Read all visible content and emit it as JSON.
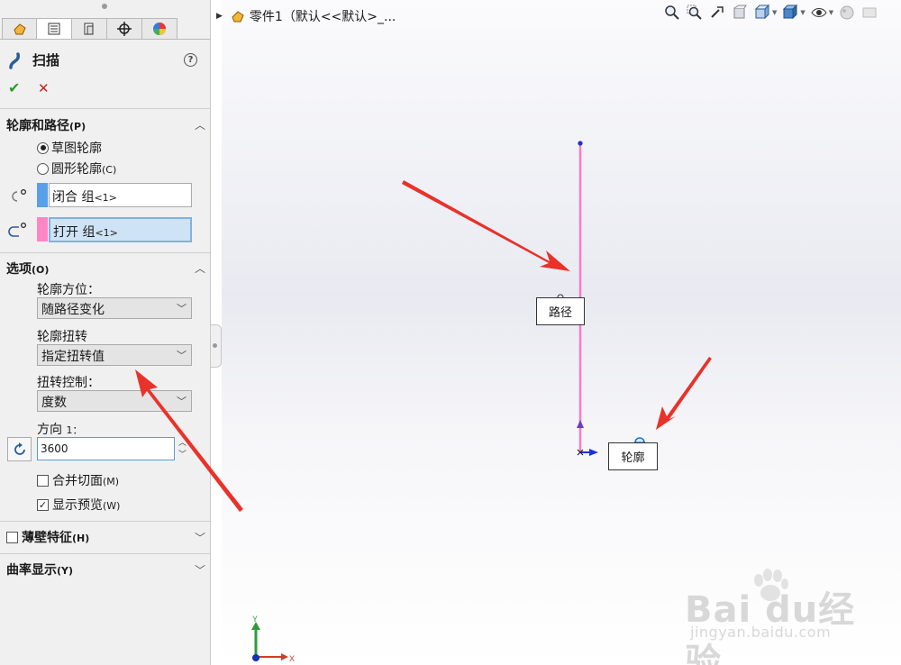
{
  "feature": {
    "title": "扫描",
    "help": "?",
    "ok_glyph": "✔",
    "cancel_glyph": "✕"
  },
  "sections": {
    "profile_path": {
      "title": "轮廓和路径",
      "key": "(P)",
      "radio_sketch": "草图轮廓",
      "radio_circle": "圆形轮廓",
      "radio_circle_key": "(C)",
      "profile_value": "闭合 组",
      "profile_suffix": "<1>",
      "path_value": "打开 组",
      "path_suffix": "<1>"
    },
    "options": {
      "title": "选项",
      "key": "(O)",
      "orientation_label": "轮廓方位：",
      "orientation_value": "随路径变化",
      "twist_label": "轮廓扭转",
      "twist_value": "指定扭转值",
      "twist_ctrl_label": "扭转控制：",
      "twist_ctrl_value": "度数",
      "direction_label": "方向",
      "direction_num": "1：",
      "direction_value": "3600",
      "merge_label": "合并切面",
      "merge_key": "(M)",
      "preview_label": "显示预览",
      "preview_key": "(W)",
      "preview_checked": true,
      "merge_checked": false
    },
    "thin": {
      "title": "薄壁特征",
      "key": "(H)"
    },
    "curvature": {
      "title": "曲率显示",
      "key": "(Y)"
    }
  },
  "viewport": {
    "tree_title": "零件1（默认<<默认>_...",
    "path_callout": "路径",
    "profile_callout": "轮廓",
    "axis_x": "X",
    "axis_y": "Y"
  },
  "watermark": {
    "brand": "Bai du经验",
    "url": "jingyan.baidu.com"
  },
  "colors": {
    "path_line": "#ff7ac8",
    "profile_swatch": "#5aa0e8",
    "path_swatch": "#ff86c6",
    "arrow_red": "#e8322a"
  }
}
